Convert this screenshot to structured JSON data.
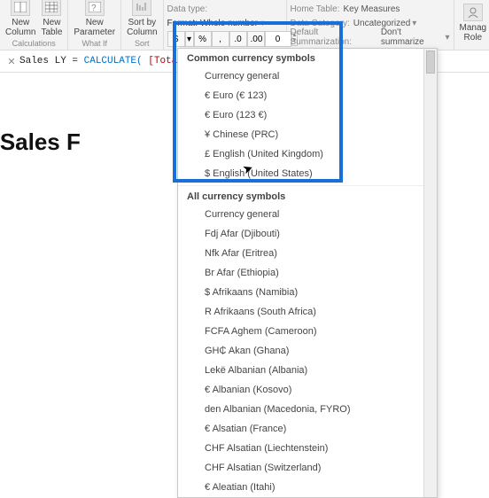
{
  "ribbon": {
    "new_column": "New\nColumn",
    "new_table": "New\nTable",
    "calc_label": "Calculations",
    "new_parameter": "New\nParameter",
    "whatif_label": "What If",
    "sort_by_column": "Sort by\nColumn",
    "sort_label": "Sort",
    "datatype_lbl": "Data type:",
    "format_lbl": "Format:",
    "format_val": "Whole number",
    "decimals": "0",
    "home_table_lbl": "Home Table:",
    "home_table_val": "Key Measures",
    "data_cat_lbl": "Data Category:",
    "data_cat_val": "Uncategorized",
    "default_summ_lbl": "Default Summarization:",
    "default_summ_val": "Don't summarize",
    "manage_roles": "Manag\nRole"
  },
  "formula": {
    "name": "Sales LY",
    "eq": " = ",
    "fn": "CALCULATE(",
    "arg": " [Total Sal"
  },
  "doc_title": "wcasing Sales F",
  "dropdown": {
    "sec1": "Common currency symbols",
    "common": [
      "Currency general",
      "€ Euro (€ 123)",
      "€ Euro (123 €)",
      "¥ Chinese (PRC)",
      "£ English (United Kingdom)",
      "$ English (United States)"
    ],
    "sec2": "All currency symbols",
    "all": [
      "Currency general",
      "Fdj Afar (Djibouti)",
      "Nfk Afar (Eritrea)",
      "Br Afar (Ethiopia)",
      "$ Afrikaans (Namibia)",
      "R Afrikaans (South Africa)",
      "FCFA Aghem (Cameroon)",
      "GH₵ Akan (Ghana)",
      "Lekë Albanian (Albania)",
      "€ Albanian (Kosovo)",
      "den Albanian (Macedonia, FYRO)",
      "€ Alsatian (France)",
      "CHF Alsatian (Liechtenstein)",
      "CHF Alsatian (Switzerland)",
      "€ Aleatian (Itahi)"
    ]
  },
  "fmt_buttons": {
    "currency": "$",
    "pct": "%",
    "comma": ",",
    "d1": ".0",
    "d2": ".00"
  }
}
